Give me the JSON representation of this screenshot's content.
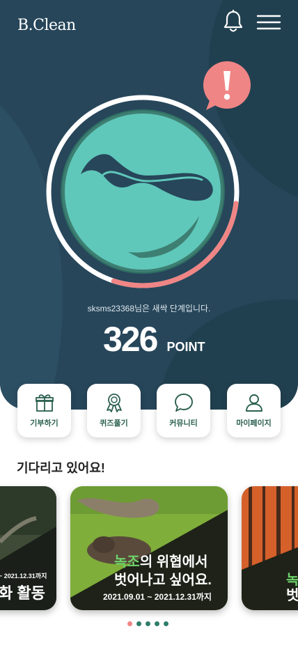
{
  "header": {
    "logo": "B.Clean",
    "bell_icon": "bell-icon",
    "menu_icon": "hamburger-menu-icon"
  },
  "colors": {
    "hero": "#27465a",
    "accent": "#5fc8ba",
    "alert": "#f08585",
    "brand_green": "#2a5f4f"
  },
  "status": {
    "message": "sksms23368님은 새싹 단계입니다.",
    "progress_fraction": 0.28
  },
  "points": {
    "value": "326",
    "unit": "POINT"
  },
  "quick_menu": [
    {
      "label": "기부하기",
      "icon": "gift-icon"
    },
    {
      "label": "퀴즈풀기",
      "icon": "award-ribbon-icon"
    },
    {
      "label": "커뮤니티",
      "icon": "chat-bubble-icon"
    },
    {
      "label": "마이페이지",
      "icon": "user-icon"
    }
  ],
  "section": {
    "title": "기다리고 있어요!"
  },
  "cards": {
    "left": {
      "date": "~ 2021.12.31까지",
      "title": "화 활동"
    },
    "center": {
      "accent": "녹조",
      "line1_rest": "의 위협에서",
      "line2": "벗어나고 싶어요.",
      "date": "2021.09.01 ~ 2021.12.31까지"
    },
    "right": {
      "accent": "녹",
      "line2": "벗"
    }
  },
  "carousel": {
    "total": 5,
    "active": 0
  }
}
